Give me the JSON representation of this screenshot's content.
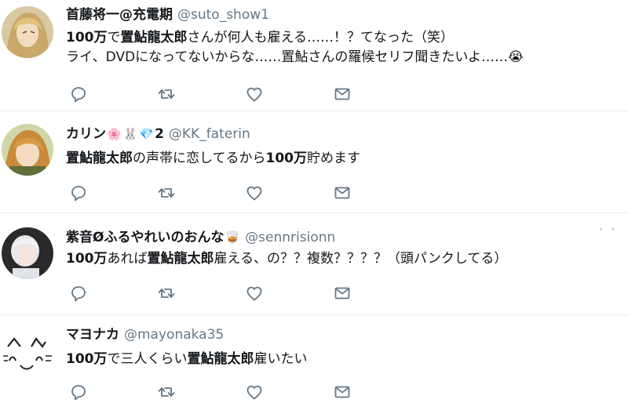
{
  "tweets": [
    {
      "name": "首藤将一@充電期",
      "handle": "@suto_show1",
      "name_emoji": [],
      "lines": [
        [
          {
            "t": "100万",
            "b": true
          },
          {
            "t": "で",
            "b": false
          },
          {
            "t": "置鮎龍太郎",
            "b": true
          },
          {
            "t": "さんが何人も雇える……！？てなった（笑）",
            "b": false
          }
        ],
        [
          {
            "t": "ライ、DVDになってないからな……置鮎さんの羅候セリフ聞きたいよ……",
            "b": false
          },
          {
            "t": "😭",
            "b": false
          }
        ]
      ],
      "actions": [
        "reply-icon",
        "retweet-icon",
        "like-icon",
        "message-icon"
      ]
    },
    {
      "name": "カリン",
      "handle": "@KK_faterin",
      "name_emoji": [
        "🌸",
        "🐰",
        "💎"
      ],
      "name_suffix": "2",
      "lines": [
        [
          {
            "t": "置鮎龍太郎",
            "b": true
          },
          {
            "t": "の声帯に恋してるから",
            "b": false
          },
          {
            "t": "100万",
            "b": true
          },
          {
            "t": "貯めます",
            "b": false
          }
        ]
      ],
      "actions": [
        "reply-icon",
        "retweet-icon",
        "like-icon",
        "message-icon"
      ]
    },
    {
      "name": "紫音Øふるやれいのおんな",
      "handle": "@sennrisionn",
      "name_emoji": [
        "🥃"
      ],
      "lines": [
        [
          {
            "t": "100万",
            "b": true
          },
          {
            "t": "あれば",
            "b": false
          },
          {
            "t": "置鮎龍太郎",
            "b": true
          },
          {
            "t": "雇える、の？？複数？？？？（頭パンクしてる）",
            "b": false
          }
        ]
      ],
      "actions": [
        "reply-icon",
        "retweet-icon",
        "like-icon",
        "message-icon"
      ]
    },
    {
      "name": "マヨナカ",
      "handle": "@mayonaka35",
      "name_emoji": [],
      "lines": [
        [
          {
            "t": "100万",
            "b": true
          },
          {
            "t": "で三人くらい",
            "b": false
          },
          {
            "t": "置鮎龍太郎",
            "b": true
          },
          {
            "t": "雇いたい",
            "b": false
          }
        ]
      ],
      "actions": [
        "reply-icon",
        "retweet-icon",
        "like-icon",
        "message-icon"
      ]
    }
  ],
  "colors": {
    "icon": "#657786",
    "handle": "#657786",
    "divider": "#e6ecf0"
  }
}
